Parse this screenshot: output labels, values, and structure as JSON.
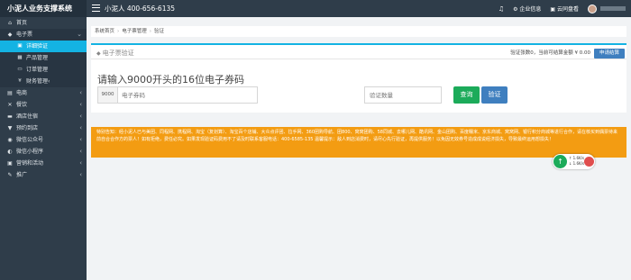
{
  "app": {
    "brand": "小泥人业务支撑系统",
    "hotline": "小泥人 400-656-6135"
  },
  "topbar": {
    "enterprise": "企业信息",
    "cloud": "云同盘看"
  },
  "sidebar": {
    "items": [
      {
        "icon": "home-icon",
        "glyph": "⌂",
        "label": "首页"
      },
      {
        "icon": "ticket-icon",
        "glyph": "◆",
        "label": "电子票",
        "open": true
      },
      {
        "icon": "shop-icon",
        "glyph": "▤",
        "label": "电商"
      },
      {
        "icon": "food-icon",
        "glyph": "✕",
        "label": "餐饮"
      },
      {
        "icon": "hotel-icon",
        "glyph": "▬",
        "label": "酒店住宿"
      },
      {
        "icon": "store-icon",
        "glyph": "▼",
        "label": "预约到店"
      },
      {
        "icon": "wechat-icon",
        "glyph": "◉",
        "label": "微信公众号"
      },
      {
        "icon": "mini-program-icon",
        "glyph": "◐",
        "label": "微信小程序"
      },
      {
        "icon": "marketing-icon",
        "glyph": "▣",
        "label": "营销和活动"
      },
      {
        "icon": "promotion-icon",
        "glyph": "✎",
        "label": "推广"
      }
    ],
    "sub_items": [
      {
        "icon": "verify-icon",
        "glyph": "▣",
        "label": "详细验证",
        "active": true
      },
      {
        "icon": "product-icon",
        "glyph": "▦",
        "label": "产品管理"
      },
      {
        "icon": "order-icon",
        "glyph": "▭",
        "label": "订单管理"
      },
      {
        "icon": "finance-icon",
        "glyph": "¥",
        "label": "财务管理"
      }
    ]
  },
  "breadcrumb": [
    "系统首页",
    "电子票管理",
    "验证"
  ],
  "panel": {
    "title": "电子票验证",
    "stats": "验证张数0，当前可结算金额 ¥ 0.00",
    "apply_label": "申请结算",
    "heading": "请输入9000开头的16位电子券码",
    "prefix": "9000",
    "code_placeholder": "电子券码",
    "qty_placeholder": "验证数量",
    "query_label": "查询",
    "verify_label": "验证"
  },
  "notice": {
    "text": "特别告知：经小泥人已与美团、同程网、携程网、淘宝（复划算）、淘宝百个店铺、大众点评团、拉手网、360团购导航、团800、窝窝团购、58同城、去哪儿网、酷讯网、金山团购、百度糯米、京东商城、窝窝网、银行积分商城等进行合作，请在核买到偶票待来前自合合作方的票人！如有拒绝，费任必究。如果发现验证码费用不了请及时联系客服电话：400-6585-135 温馨提示：敌人到店消费时，请尽心先行验证，再提供服务！以免因无效券号造成成说经济损失，导致最终运用想损失！"
  },
  "widget": {
    "up": "↑ 1.6K/s",
    "down": "↓ 1.6K/s",
    "colors": {
      "green": "#1cab5a",
      "red": "#e04e4e"
    }
  },
  "colors": {
    "accent": "#14b3e3",
    "primary": "#3f7fbf",
    "success": "#1cab5a",
    "warning": "#f39c12",
    "sidebar": "#2f3d4a"
  }
}
